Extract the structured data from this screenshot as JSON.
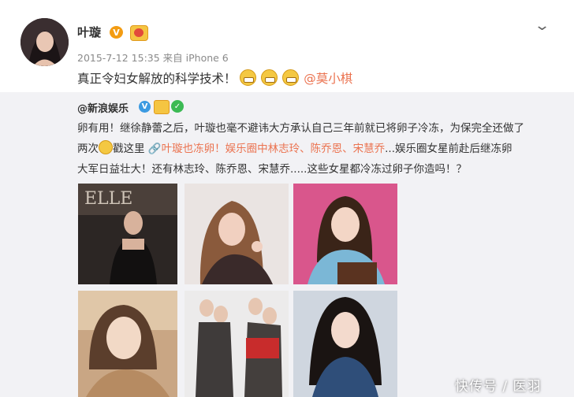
{
  "post": {
    "author": "叶璇",
    "verified_badge": "V",
    "meta": "2015-7-12 15:35 来自 iPhone 6",
    "text": "真正令妇女解放的科学技术！",
    "mention": "@莫小棋"
  },
  "retweet": {
    "author": "@新浪娱乐",
    "verified_badge": "V",
    "line1": "卵有用！继徐静蕾之后，叶璇也毫不避讳大方承认自己三年前就已将卵子冷冻，为保完全还做了",
    "line2_start": "两次",
    "line2_mid": "戳这里",
    "line2_link": "叶璇也冻卵！娱乐圈中林志玲、陈乔恩、宋慧乔",
    "line2_end": "...娱乐圈女星前赴后继冻卵",
    "line3": "大军日益壮大！还有林志玲、陈乔恩、宋慧乔.....这些女星都冷冻过卵子你造吗！？"
  },
  "watermark": "快传号 / 医羽",
  "colors": {
    "link": "#eb7350",
    "retweet_bg": "#f2f2f5",
    "verified_orange": "#f39c12",
    "verified_blue": "#3b9ae1"
  }
}
